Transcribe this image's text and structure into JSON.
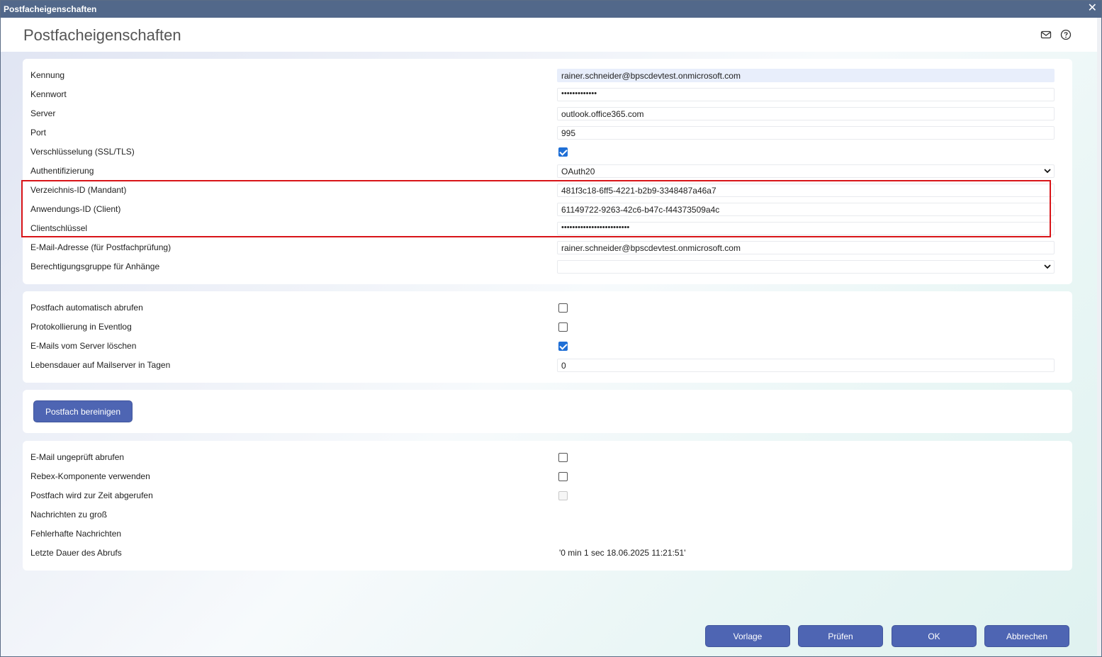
{
  "window": {
    "title": "Postfacheigenschaften",
    "close_glyph": "✕"
  },
  "header": {
    "title": "Postfacheigenschaften",
    "icons": [
      "mail-icon",
      "help-icon"
    ]
  },
  "section1": {
    "kennung": {
      "label": "Kennung",
      "value": "rainer.schneider@bpscdevtest.onmicrosoft.com"
    },
    "kennwort": {
      "label": "Kennwort",
      "value": "•••••••••••••"
    },
    "server": {
      "label": "Server",
      "value": "outlook.office365.com"
    },
    "port": {
      "label": "Port",
      "value": "995"
    },
    "ssl": {
      "label": "Verschlüsselung (SSL/TLS)",
      "checked": true
    },
    "auth": {
      "label": "Authentifizierung",
      "value": "OAuth20"
    },
    "tenant": {
      "label": "Verzeichnis-ID (Mandant)",
      "value": "481f3c18-6ff5-4221-b2b9-3348487a46a7"
    },
    "client": {
      "label": "Anwendungs-ID (Client)",
      "value": "61149722-9263-42c6-b47c-f44373509a4c"
    },
    "secret": {
      "label": "Clientschlüssel",
      "value": "•••••••••••••••••••••••••"
    },
    "email": {
      "label": "E-Mail-Adresse (für Postfachprüfung)",
      "value": "rainer.schneider@bpscdevtest.onmicrosoft.com"
    },
    "group": {
      "label": "Berechtigungsgruppe für Anhänge",
      "value": ""
    }
  },
  "section2": {
    "auto": {
      "label": "Postfach automatisch abrufen",
      "checked": false
    },
    "eventlog": {
      "label": "Protokollierung in Eventlog",
      "checked": false
    },
    "delete": {
      "label": "E-Mails vom Server löschen",
      "checked": true
    },
    "lifetime": {
      "label": "Lebensdauer auf Mailserver in Tagen",
      "value": "0"
    }
  },
  "section3": {
    "clean_button": "Postfach bereinigen"
  },
  "section4": {
    "unchecked": {
      "label": "E-Mail ungeprüft abrufen",
      "checked": false
    },
    "rebex": {
      "label": "Rebex-Komponente verwenden",
      "checked": false
    },
    "busy": {
      "label": "Postfach wird zur Zeit abgerufen",
      "checked": false,
      "disabled": true
    },
    "toobig": {
      "label": "Nachrichten zu groß",
      "value": ""
    },
    "faulty": {
      "label": "Fehlerhafte Nachrichten",
      "value": ""
    },
    "duration": {
      "label": "Letzte Dauer des Abrufs",
      "value": "'0 min 1 sec 18.06.2025 11:21:51'"
    }
  },
  "footer": {
    "template": "Vorlage",
    "check": "Prüfen",
    "ok": "OK",
    "cancel": "Abbrechen"
  },
  "colors": {
    "titlebar": "#52688a",
    "button": "#4e65b3",
    "highlight_border": "#d81418",
    "checkbox": "#1f6fd6"
  }
}
